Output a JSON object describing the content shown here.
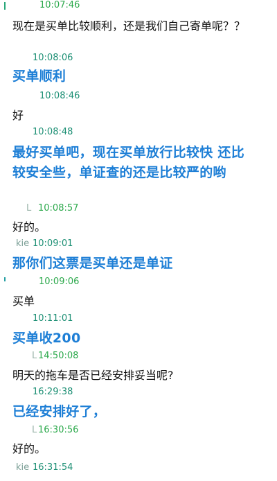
{
  "colors": {
    "meta_teal": "#1c8f74",
    "meta_green": "#2aa84a",
    "bold_blue": "#1e7fd6",
    "text": "#111111"
  },
  "messages": [
    {
      "sender": "",
      "time": "10:07:46",
      "text": ""
    },
    {
      "sender": "",
      "time": "",
      "text": "现在是买单比较顺利，还是我们自己寄单呢？？"
    },
    {
      "sender": "",
      "time": "10:08:06",
      "text": ""
    },
    {
      "sender": "",
      "time": "",
      "text": "买单顺利"
    },
    {
      "sender": "",
      "time": "10:08:46",
      "text": ""
    },
    {
      "sender": "",
      "time": "",
      "text": "好"
    },
    {
      "sender": "",
      "time": "10:08:48",
      "text": ""
    },
    {
      "sender": "",
      "time": "",
      "text": "最好买单吧，现在买单放行比较快 还比较安全些，单证查的还是比较严的哟"
    },
    {
      "sender": "L",
      "time": "10:08:57",
      "text": ""
    },
    {
      "sender": "",
      "time": "",
      "text": "好的。"
    },
    {
      "sender": "kie",
      "time": "10:09:01",
      "text": ""
    },
    {
      "sender": "",
      "time": "",
      "text": "那你们这票是买单还是单证"
    },
    {
      "sender": "",
      "time": "10:09:06",
      "text": ""
    },
    {
      "sender": "",
      "time": "",
      "text": "买单"
    },
    {
      "sender": "",
      "time": "10:11:01",
      "text": ""
    },
    {
      "sender": "",
      "time": "",
      "text": "买单收200"
    },
    {
      "sender": "L",
      "time": "14:50:08",
      "text": ""
    },
    {
      "sender": "",
      "time": "",
      "text": "明天的拖车是否已经安排妥当呢?"
    },
    {
      "sender": "",
      "time": "16:29:38",
      "text": ""
    },
    {
      "sender": "",
      "time": "",
      "text": "已经安排好了，"
    },
    {
      "sender": "L",
      "time": "16:30:56",
      "text": ""
    },
    {
      "sender": "",
      "time": "",
      "text": "好的。"
    },
    {
      "sender": "kie",
      "time": "16:31:54",
      "text": ""
    }
  ]
}
